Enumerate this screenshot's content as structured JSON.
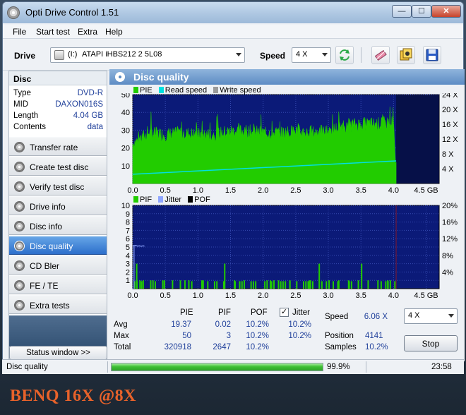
{
  "window": {
    "title": "Opti Drive Control 1.51"
  },
  "menu": [
    "File",
    "Start test",
    "Extra",
    "Help"
  ],
  "toolbar": {
    "drive_label": "Drive",
    "drive_letter": "(I:)",
    "drive_name": "ATAPI iHBS212  2 5L08",
    "speed_label": "Speed",
    "speed_value": "4 X"
  },
  "disc": {
    "header": "Disc",
    "rows": [
      {
        "key": "Type",
        "value": "DVD-R"
      },
      {
        "key": "MID",
        "value": "DAXON016S"
      },
      {
        "key": "Length",
        "value": "4.04 GB"
      },
      {
        "key": "Contents",
        "value": "data"
      }
    ]
  },
  "nav": [
    {
      "label": "Transfer rate",
      "active": false
    },
    {
      "label": "Create test disc",
      "active": false
    },
    {
      "label": "Verify test disc",
      "active": false
    },
    {
      "label": "Drive info",
      "active": false
    },
    {
      "label": "Disc info",
      "active": false
    },
    {
      "label": "Disc quality",
      "active": true
    },
    {
      "label": "CD Bler",
      "active": false
    },
    {
      "label": "FE / TE",
      "active": false
    },
    {
      "label": "Extra tests",
      "active": false
    }
  ],
  "status_window_button": "Status window >>",
  "main": {
    "title": "Disc quality"
  },
  "chart_data": [
    {
      "type": "area",
      "legend": [
        "PIE",
        "Read speed",
        "Write speed"
      ],
      "colors": {
        "PIE": "#22cc00",
        "Read speed": "#00e0e0",
        "Write speed": "#9a9a9a",
        "background": "#0b1a78",
        "grid": "#3549b0"
      },
      "x_ticks": [
        "0.0",
        "0.5",
        "1.0",
        "1.5",
        "2.0",
        "2.5",
        "3.0",
        "3.5",
        "4.0",
        "4.5 GB"
      ],
      "xlim": [
        0,
        4.7
      ],
      "y_ticks_left": [
        "50",
        "40",
        "30",
        "20",
        "10"
      ],
      "ylim_left": [
        0,
        50
      ],
      "y_ticks_right": [
        "24 X",
        "20 X",
        "16 X",
        "12 X",
        "8 X",
        "4 X"
      ],
      "ylim_right": [
        0,
        24
      ],
      "data_end_gb": 4.04,
      "pie_series": {
        "x": [
          0.0,
          0.25,
          0.5,
          0.75,
          1.0,
          1.25,
          1.5,
          1.75,
          2.0,
          2.25,
          2.5,
          2.75,
          3.0,
          3.25,
          3.5,
          3.75,
          4.0,
          4.04
        ],
        "y": [
          22,
          28,
          27,
          28,
          27,
          27,
          29,
          29,
          28,
          28,
          29,
          28,
          29,
          32,
          33,
          33,
          34,
          0
        ]
      },
      "read_speed": {
        "x": [
          0.0,
          4.04
        ],
        "y": [
          2.5,
          6.1
        ]
      }
    },
    {
      "type": "bar",
      "legend": [
        "PIF",
        "Jitter",
        "POF"
      ],
      "colors": {
        "PIF": "#22cc00",
        "Jitter": "#8fa6ff",
        "POF": "#000000",
        "background": "#0b1a78",
        "grid": "#3549b0"
      },
      "x_ticks": [
        "0.0",
        "0.5",
        "1.0",
        "1.5",
        "2.0",
        "2.5",
        "3.0",
        "3.5",
        "4.0",
        "4.5 GB"
      ],
      "xlim": [
        0,
        4.7
      ],
      "y_ticks_left": [
        "10",
        "9",
        "8",
        "7",
        "6",
        "5",
        "4",
        "3",
        "2",
        "1"
      ],
      "ylim_left": [
        0,
        10
      ],
      "y_ticks_right": [
        "20%",
        "16%",
        "12%",
        "8%",
        "4%"
      ],
      "ylim_right": [
        0,
        20
      ],
      "pif_spikes": {
        "x": [
          0.05,
          0.1,
          0.15,
          0.3,
          0.45,
          0.6,
          0.85,
          1.05,
          1.4,
          1.55,
          1.7,
          2.1,
          2.4,
          2.7,
          2.85,
          3.0,
          3.15,
          3.3,
          3.45,
          3.5,
          3.6,
          3.75,
          3.9
        ],
        "y": [
          3,
          1,
          1,
          1,
          1,
          1,
          1,
          1,
          3,
          1,
          1,
          1,
          1,
          1,
          3,
          1,
          1,
          1,
          1,
          3,
          1,
          1,
          1
        ]
      },
      "jitter_start": {
        "x": [
          0.0,
          0.02,
          0.04,
          0.06,
          0.08,
          0.1,
          0.12,
          0.14,
          0.16,
          0.18
        ],
        "y": [
          10.4,
          10.3,
          10.4,
          10.3,
          10.2,
          10.3,
          10.2,
          10.2,
          10.3,
          10.2
        ]
      }
    }
  ],
  "stats": {
    "headers": [
      "PIE",
      "PIF",
      "POF",
      "Jitter"
    ],
    "rows": [
      {
        "label": "Avg",
        "values": [
          "19.37",
          "0.02",
          "10.2%",
          "10.2%"
        ]
      },
      {
        "label": "Max",
        "values": [
          "50",
          "3",
          "10.2%",
          "10.2%"
        ]
      },
      {
        "label": "Total",
        "values": [
          "320918",
          "2647",
          "10.2%",
          ""
        ]
      }
    ],
    "jitter_checked": true,
    "speed_label": "Speed",
    "speed_value": "6.06 X",
    "position_label": "Position",
    "position_value": "4141",
    "samples_label": "Samples",
    "samples_value": "10.2%",
    "right_select": "4 X",
    "stop_button": "Stop"
  },
  "statusbar": {
    "left": "Disc quality",
    "progress_fraction": 0.999,
    "percent": "99.9%",
    "time": "23:58"
  },
  "caption": "BENQ 16X @8X"
}
